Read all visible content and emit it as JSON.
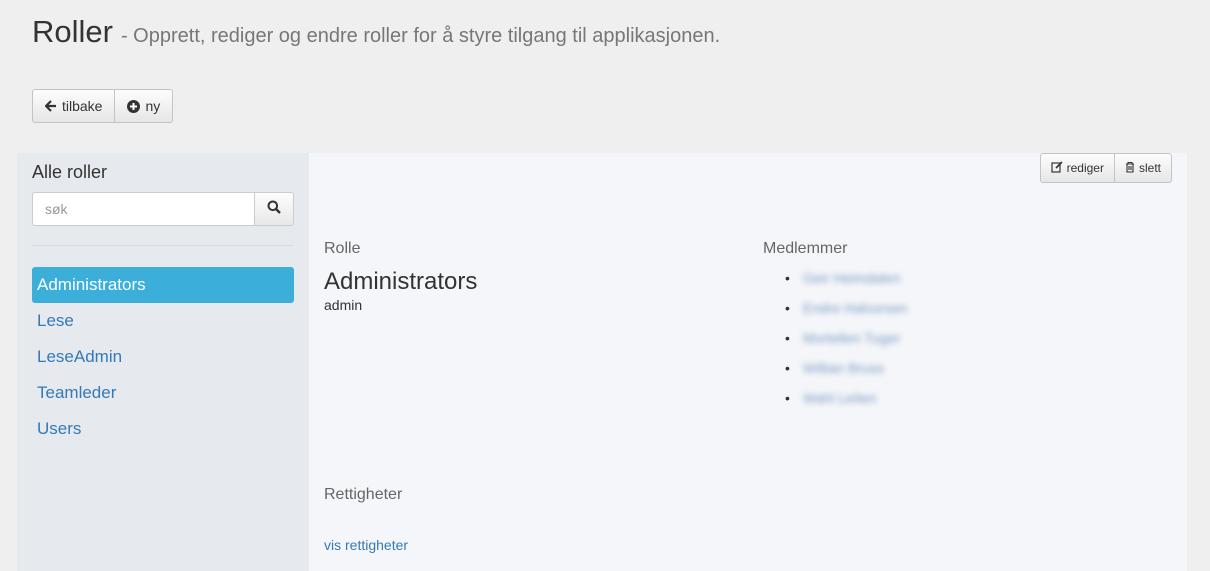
{
  "header": {
    "title": "Roller",
    "subtitle": "- Opprett, rediger og endre roller for å styre tilgang til applikasjonen."
  },
  "toolbar": {
    "back_label": "tilbake",
    "new_label": "ny",
    "back_icon": "arrow-left-icon",
    "new_icon": "plus-circle-icon"
  },
  "sidebar": {
    "title": "Alle roller",
    "search_placeholder": "søk",
    "search_icon": "search-icon",
    "items": [
      {
        "label": "Administrators",
        "active": true
      },
      {
        "label": "Lese",
        "active": false
      },
      {
        "label": "LeseAdmin",
        "active": false
      },
      {
        "label": "Teamleder",
        "active": false
      },
      {
        "label": "Users",
        "active": false
      }
    ]
  },
  "detail": {
    "edit_label": "rediger",
    "delete_label": "slett",
    "role_heading": "Rolle",
    "role_name": "Administrators",
    "role_code": "admin",
    "members_heading": "Medlemmer",
    "members": [
      "Geir Heimdalen",
      "Endre Halvorsen",
      "Mortellen Tuger",
      "Willian Bruss",
      "Wahl Leiten"
    ],
    "permissions_heading": "Rettigheter",
    "permissions_link": "vis rettigheter"
  },
  "colors": {
    "accent": "#3bafda",
    "link": "#337ab7",
    "sidebar_bg": "#e6e9ee",
    "content_bg": "#f4f6f9"
  }
}
